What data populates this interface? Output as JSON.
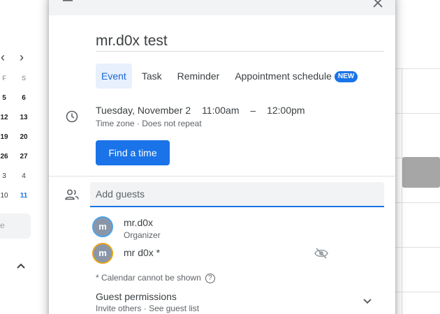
{
  "background": {
    "mini_calendar": {
      "weekday_headers": [
        "F",
        "S"
      ],
      "rows": [
        [
          "5",
          "6"
        ],
        [
          "12",
          "13"
        ],
        [
          "19",
          "20"
        ],
        [
          "26",
          "27"
        ],
        [
          "3",
          "4"
        ],
        [
          "10",
          "11"
        ]
      ]
    },
    "search_fragment": "e"
  },
  "dialog": {
    "title": "mr.d0x test",
    "tabs": [
      {
        "label": "Event",
        "active": true
      },
      {
        "label": "Task"
      },
      {
        "label": "Reminder"
      },
      {
        "label": "Appointment schedule",
        "badge": "NEW"
      }
    ],
    "date": "Tuesday, November 2",
    "start_time": "11:00am",
    "time_separator": "–",
    "end_time": "12:00pm",
    "time_zone_label": "Time zone",
    "separator": "·",
    "repeat_label": "Does not repeat",
    "find_time_button": "Find a time",
    "guests": {
      "placeholder": "Add guests",
      "list": [
        {
          "initial": "m",
          "name": "mr.d0x",
          "role": "Organizer",
          "ring": "#4da3e8"
        },
        {
          "initial": "m",
          "name": "mr d0x *",
          "role": "",
          "ring": "#e8a317"
        }
      ],
      "note": "* Calendar cannot be shown",
      "permissions_title": "Guest permissions",
      "permissions_invite": "Invite others",
      "permissions_list": "See guest list"
    }
  },
  "colors": {
    "accent": "#1a73e8",
    "active_tab_bg": "#e8f0fe"
  }
}
